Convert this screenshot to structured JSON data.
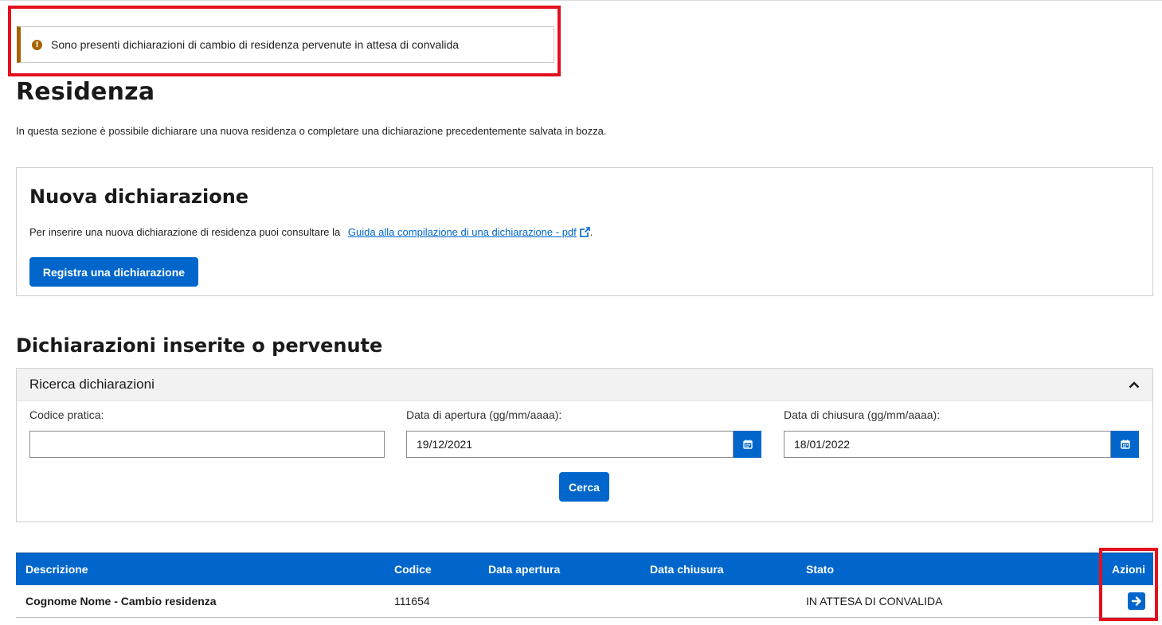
{
  "alert": {
    "icon": "exclamation-circle-icon",
    "message": "Sono presenti dichiarazioni di cambio di residenza pervenute in attesa di convalida"
  },
  "page": {
    "title": "Residenza",
    "intro": "In questa sezione è possibile dichiarare una nuova residenza o completare una dichiarazione precedentemente salvata in bozza."
  },
  "new_declaration": {
    "title": "Nuova dichiarazione",
    "guide_prefix": "Per inserire una nuova dichiarazione di residenza puoi consultare la",
    "guide_link": "Guida alla compilazione di una dichiarazione - pdf",
    "guide_suffix": ".",
    "register_button": "Registra una dichiarazione"
  },
  "declarations": {
    "section_title": "Dichiarazioni inserite o pervenute",
    "search": {
      "title": "Ricerca dichiarazioni",
      "code_label": "Codice pratica:",
      "code_value": "",
      "open_date_label": "Data di apertura (gg/mm/aaaa):",
      "open_date_value": "19/12/2021",
      "close_date_label": "Data di chiusura (gg/mm/aaaa):",
      "close_date_value": "18/01/2022",
      "search_button": "Cerca"
    },
    "table": {
      "headers": {
        "description": "Descrizione",
        "code": "Codice",
        "open_date": "Data apertura",
        "close_date": "Data chiusura",
        "status": "Stato",
        "actions": "Azioni"
      },
      "rows": [
        {
          "description": "Cognome Nome - Cambio residenza",
          "code": "111654",
          "open_date": "",
          "close_date": "",
          "status": "IN ATTESA DI CONVALIDA"
        }
      ]
    }
  },
  "colors": {
    "primary": "#0066cc",
    "warning": "#a66300",
    "highlight": "#e3101e"
  }
}
